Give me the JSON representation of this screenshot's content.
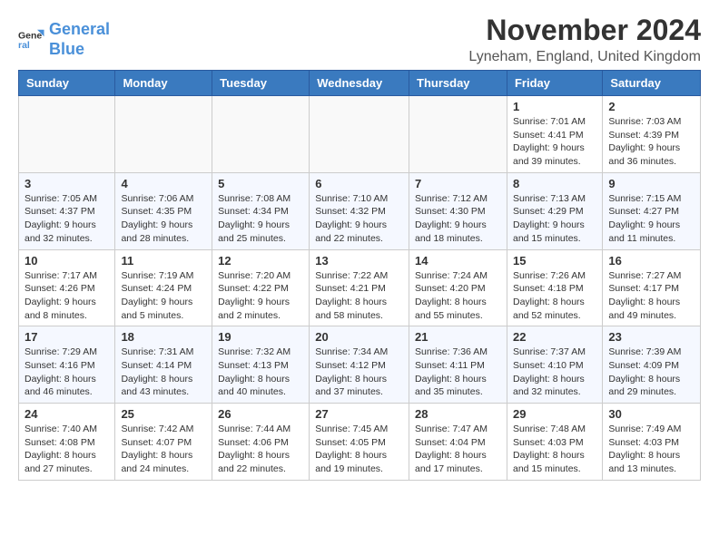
{
  "header": {
    "logo_line1": "General",
    "logo_line2": "Blue",
    "month_title": "November 2024",
    "location": "Lyneham, England, United Kingdom"
  },
  "days_of_week": [
    "Sunday",
    "Monday",
    "Tuesday",
    "Wednesday",
    "Thursday",
    "Friday",
    "Saturday"
  ],
  "weeks": [
    [
      {
        "day": "",
        "info": ""
      },
      {
        "day": "",
        "info": ""
      },
      {
        "day": "",
        "info": ""
      },
      {
        "day": "",
        "info": ""
      },
      {
        "day": "",
        "info": ""
      },
      {
        "day": "1",
        "info": "Sunrise: 7:01 AM\nSunset: 4:41 PM\nDaylight: 9 hours\nand 39 minutes."
      },
      {
        "day": "2",
        "info": "Sunrise: 7:03 AM\nSunset: 4:39 PM\nDaylight: 9 hours\nand 36 minutes."
      }
    ],
    [
      {
        "day": "3",
        "info": "Sunrise: 7:05 AM\nSunset: 4:37 PM\nDaylight: 9 hours\nand 32 minutes."
      },
      {
        "day": "4",
        "info": "Sunrise: 7:06 AM\nSunset: 4:35 PM\nDaylight: 9 hours\nand 28 minutes."
      },
      {
        "day": "5",
        "info": "Sunrise: 7:08 AM\nSunset: 4:34 PM\nDaylight: 9 hours\nand 25 minutes."
      },
      {
        "day": "6",
        "info": "Sunrise: 7:10 AM\nSunset: 4:32 PM\nDaylight: 9 hours\nand 22 minutes."
      },
      {
        "day": "7",
        "info": "Sunrise: 7:12 AM\nSunset: 4:30 PM\nDaylight: 9 hours\nand 18 minutes."
      },
      {
        "day": "8",
        "info": "Sunrise: 7:13 AM\nSunset: 4:29 PM\nDaylight: 9 hours\nand 15 minutes."
      },
      {
        "day": "9",
        "info": "Sunrise: 7:15 AM\nSunset: 4:27 PM\nDaylight: 9 hours\nand 11 minutes."
      }
    ],
    [
      {
        "day": "10",
        "info": "Sunrise: 7:17 AM\nSunset: 4:26 PM\nDaylight: 9 hours\nand 8 minutes."
      },
      {
        "day": "11",
        "info": "Sunrise: 7:19 AM\nSunset: 4:24 PM\nDaylight: 9 hours\nand 5 minutes."
      },
      {
        "day": "12",
        "info": "Sunrise: 7:20 AM\nSunset: 4:22 PM\nDaylight: 9 hours\nand 2 minutes."
      },
      {
        "day": "13",
        "info": "Sunrise: 7:22 AM\nSunset: 4:21 PM\nDaylight: 8 hours\nand 58 minutes."
      },
      {
        "day": "14",
        "info": "Sunrise: 7:24 AM\nSunset: 4:20 PM\nDaylight: 8 hours\nand 55 minutes."
      },
      {
        "day": "15",
        "info": "Sunrise: 7:26 AM\nSunset: 4:18 PM\nDaylight: 8 hours\nand 52 minutes."
      },
      {
        "day": "16",
        "info": "Sunrise: 7:27 AM\nSunset: 4:17 PM\nDaylight: 8 hours\nand 49 minutes."
      }
    ],
    [
      {
        "day": "17",
        "info": "Sunrise: 7:29 AM\nSunset: 4:16 PM\nDaylight: 8 hours\nand 46 minutes."
      },
      {
        "day": "18",
        "info": "Sunrise: 7:31 AM\nSunset: 4:14 PM\nDaylight: 8 hours\nand 43 minutes."
      },
      {
        "day": "19",
        "info": "Sunrise: 7:32 AM\nSunset: 4:13 PM\nDaylight: 8 hours\nand 40 minutes."
      },
      {
        "day": "20",
        "info": "Sunrise: 7:34 AM\nSunset: 4:12 PM\nDaylight: 8 hours\nand 37 minutes."
      },
      {
        "day": "21",
        "info": "Sunrise: 7:36 AM\nSunset: 4:11 PM\nDaylight: 8 hours\nand 35 minutes."
      },
      {
        "day": "22",
        "info": "Sunrise: 7:37 AM\nSunset: 4:10 PM\nDaylight: 8 hours\nand 32 minutes."
      },
      {
        "day": "23",
        "info": "Sunrise: 7:39 AM\nSunset: 4:09 PM\nDaylight: 8 hours\nand 29 minutes."
      }
    ],
    [
      {
        "day": "24",
        "info": "Sunrise: 7:40 AM\nSunset: 4:08 PM\nDaylight: 8 hours\nand 27 minutes."
      },
      {
        "day": "25",
        "info": "Sunrise: 7:42 AM\nSunset: 4:07 PM\nDaylight: 8 hours\nand 24 minutes."
      },
      {
        "day": "26",
        "info": "Sunrise: 7:44 AM\nSunset: 4:06 PM\nDaylight: 8 hours\nand 22 minutes."
      },
      {
        "day": "27",
        "info": "Sunrise: 7:45 AM\nSunset: 4:05 PM\nDaylight: 8 hours\nand 19 minutes."
      },
      {
        "day": "28",
        "info": "Sunrise: 7:47 AM\nSunset: 4:04 PM\nDaylight: 8 hours\nand 17 minutes."
      },
      {
        "day": "29",
        "info": "Sunrise: 7:48 AM\nSunset: 4:03 PM\nDaylight: 8 hours\nand 15 minutes."
      },
      {
        "day": "30",
        "info": "Sunrise: 7:49 AM\nSunset: 4:03 PM\nDaylight: 8 hours\nand 13 minutes."
      }
    ]
  ]
}
